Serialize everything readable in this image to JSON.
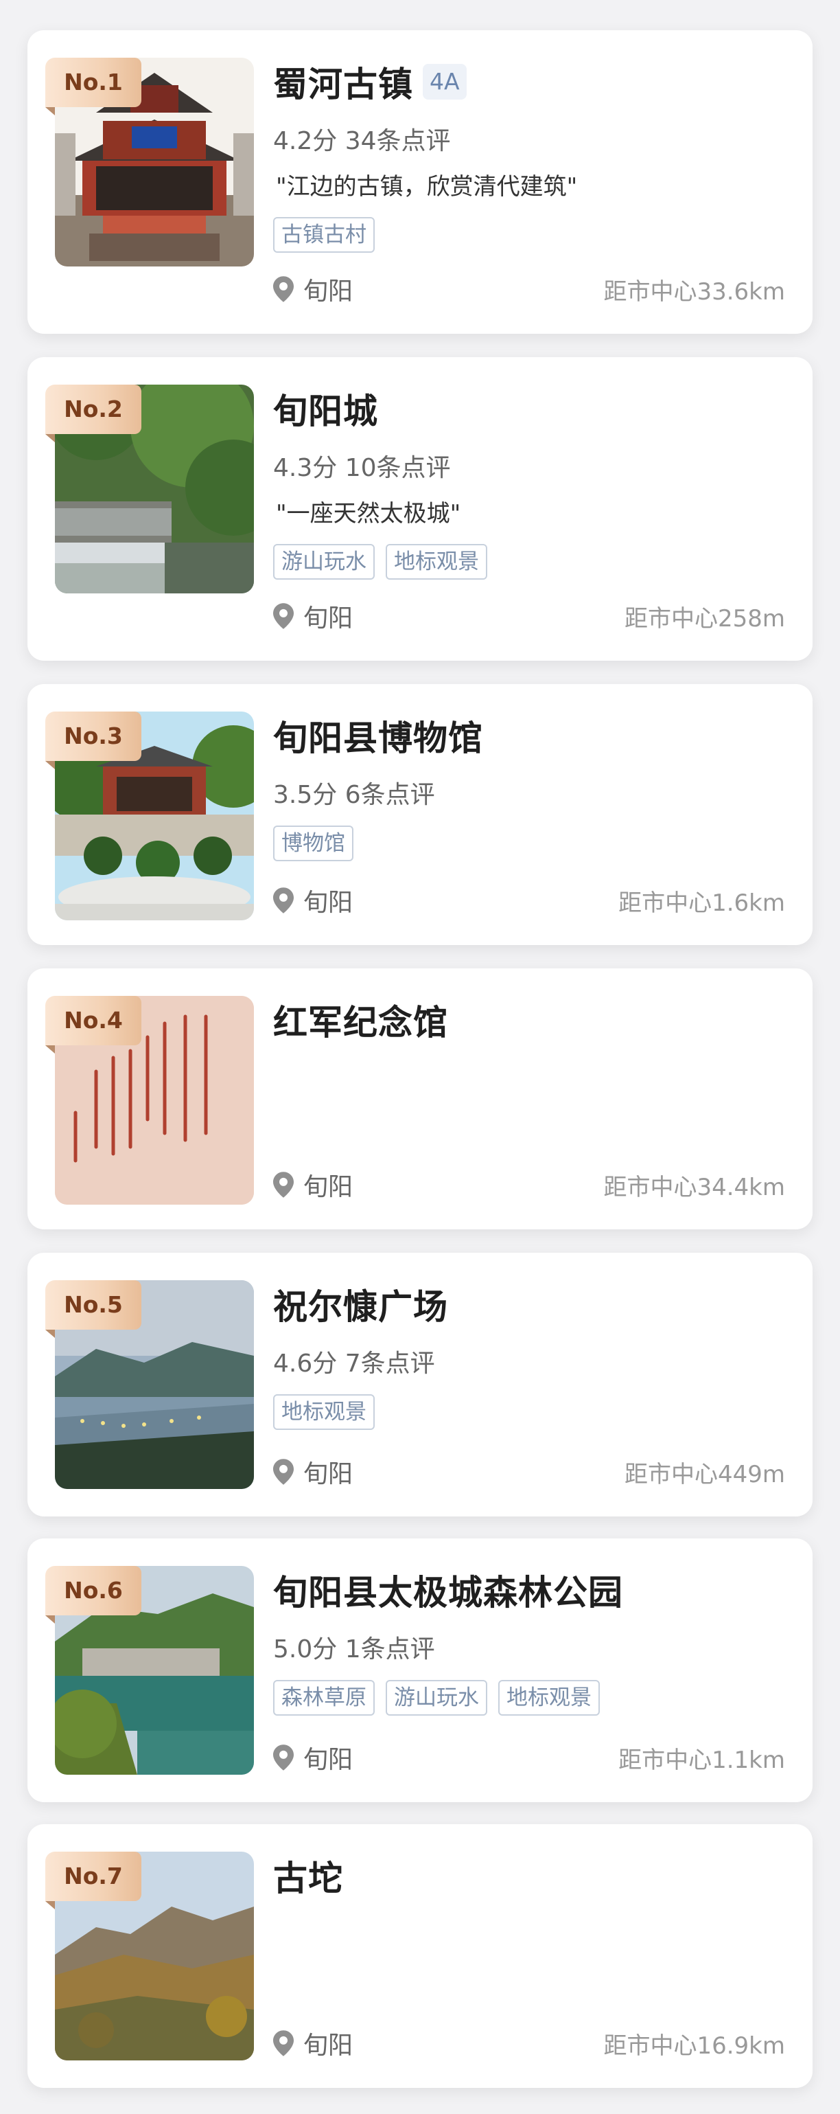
{
  "location_icon": "map-pin-icon",
  "spots": [
    {
      "rank": "No.1",
      "name": "蜀河古镇",
      "level": "4A",
      "rating": "4.2分 34条点评",
      "quote": "\"江边的古镇，欣赏清代建筑\"",
      "tags": [
        "古镇古村"
      ],
      "area": "旬阳",
      "distance": "距市中心33.6km",
      "image": "ancient-gate-tower-image"
    },
    {
      "rank": "No.2",
      "name": "旬阳城",
      "rating": "4.3分 10条点评",
      "quote": "\"一座天然太极城\"",
      "tags": [
        "游山玩水",
        "地标观景"
      ],
      "area": "旬阳",
      "distance": "距市中心258m",
      "image": "waterfall-weir-image"
    },
    {
      "rank": "No.3",
      "name": "旬阳县博物馆",
      "rating": "3.5分 6条点评",
      "tags": [
        "博物馆"
      ],
      "area": "旬阳",
      "distance": "距市中心1.6km",
      "image": "museum-courtyard-image"
    },
    {
      "rank": "No.4",
      "name": "红军纪念馆",
      "area": "旬阳",
      "distance": "距市中心34.4km",
      "image": "calligraphy-wall-image"
    },
    {
      "rank": "No.5",
      "name": "祝尔慷广场",
      "rating": "4.6分 7条点评",
      "tags": [
        "地标观景"
      ],
      "area": "旬阳",
      "distance": "距市中心449m",
      "image": "river-night-view-image"
    },
    {
      "rank": "No.6",
      "name": "旬阳县太极城森林公园",
      "rating": "5.0分 1条点评",
      "tags": [
        "森林草原",
        "游山玩水",
        "地标观景"
      ],
      "area": "旬阳",
      "distance": "距市中心1.1km",
      "image": "green-river-forest-image"
    },
    {
      "rank": "No.7",
      "name": "古坨",
      "area": "旬阳",
      "distance": "距市中心16.9km",
      "image": "autumn-mountain-image"
    }
  ]
}
